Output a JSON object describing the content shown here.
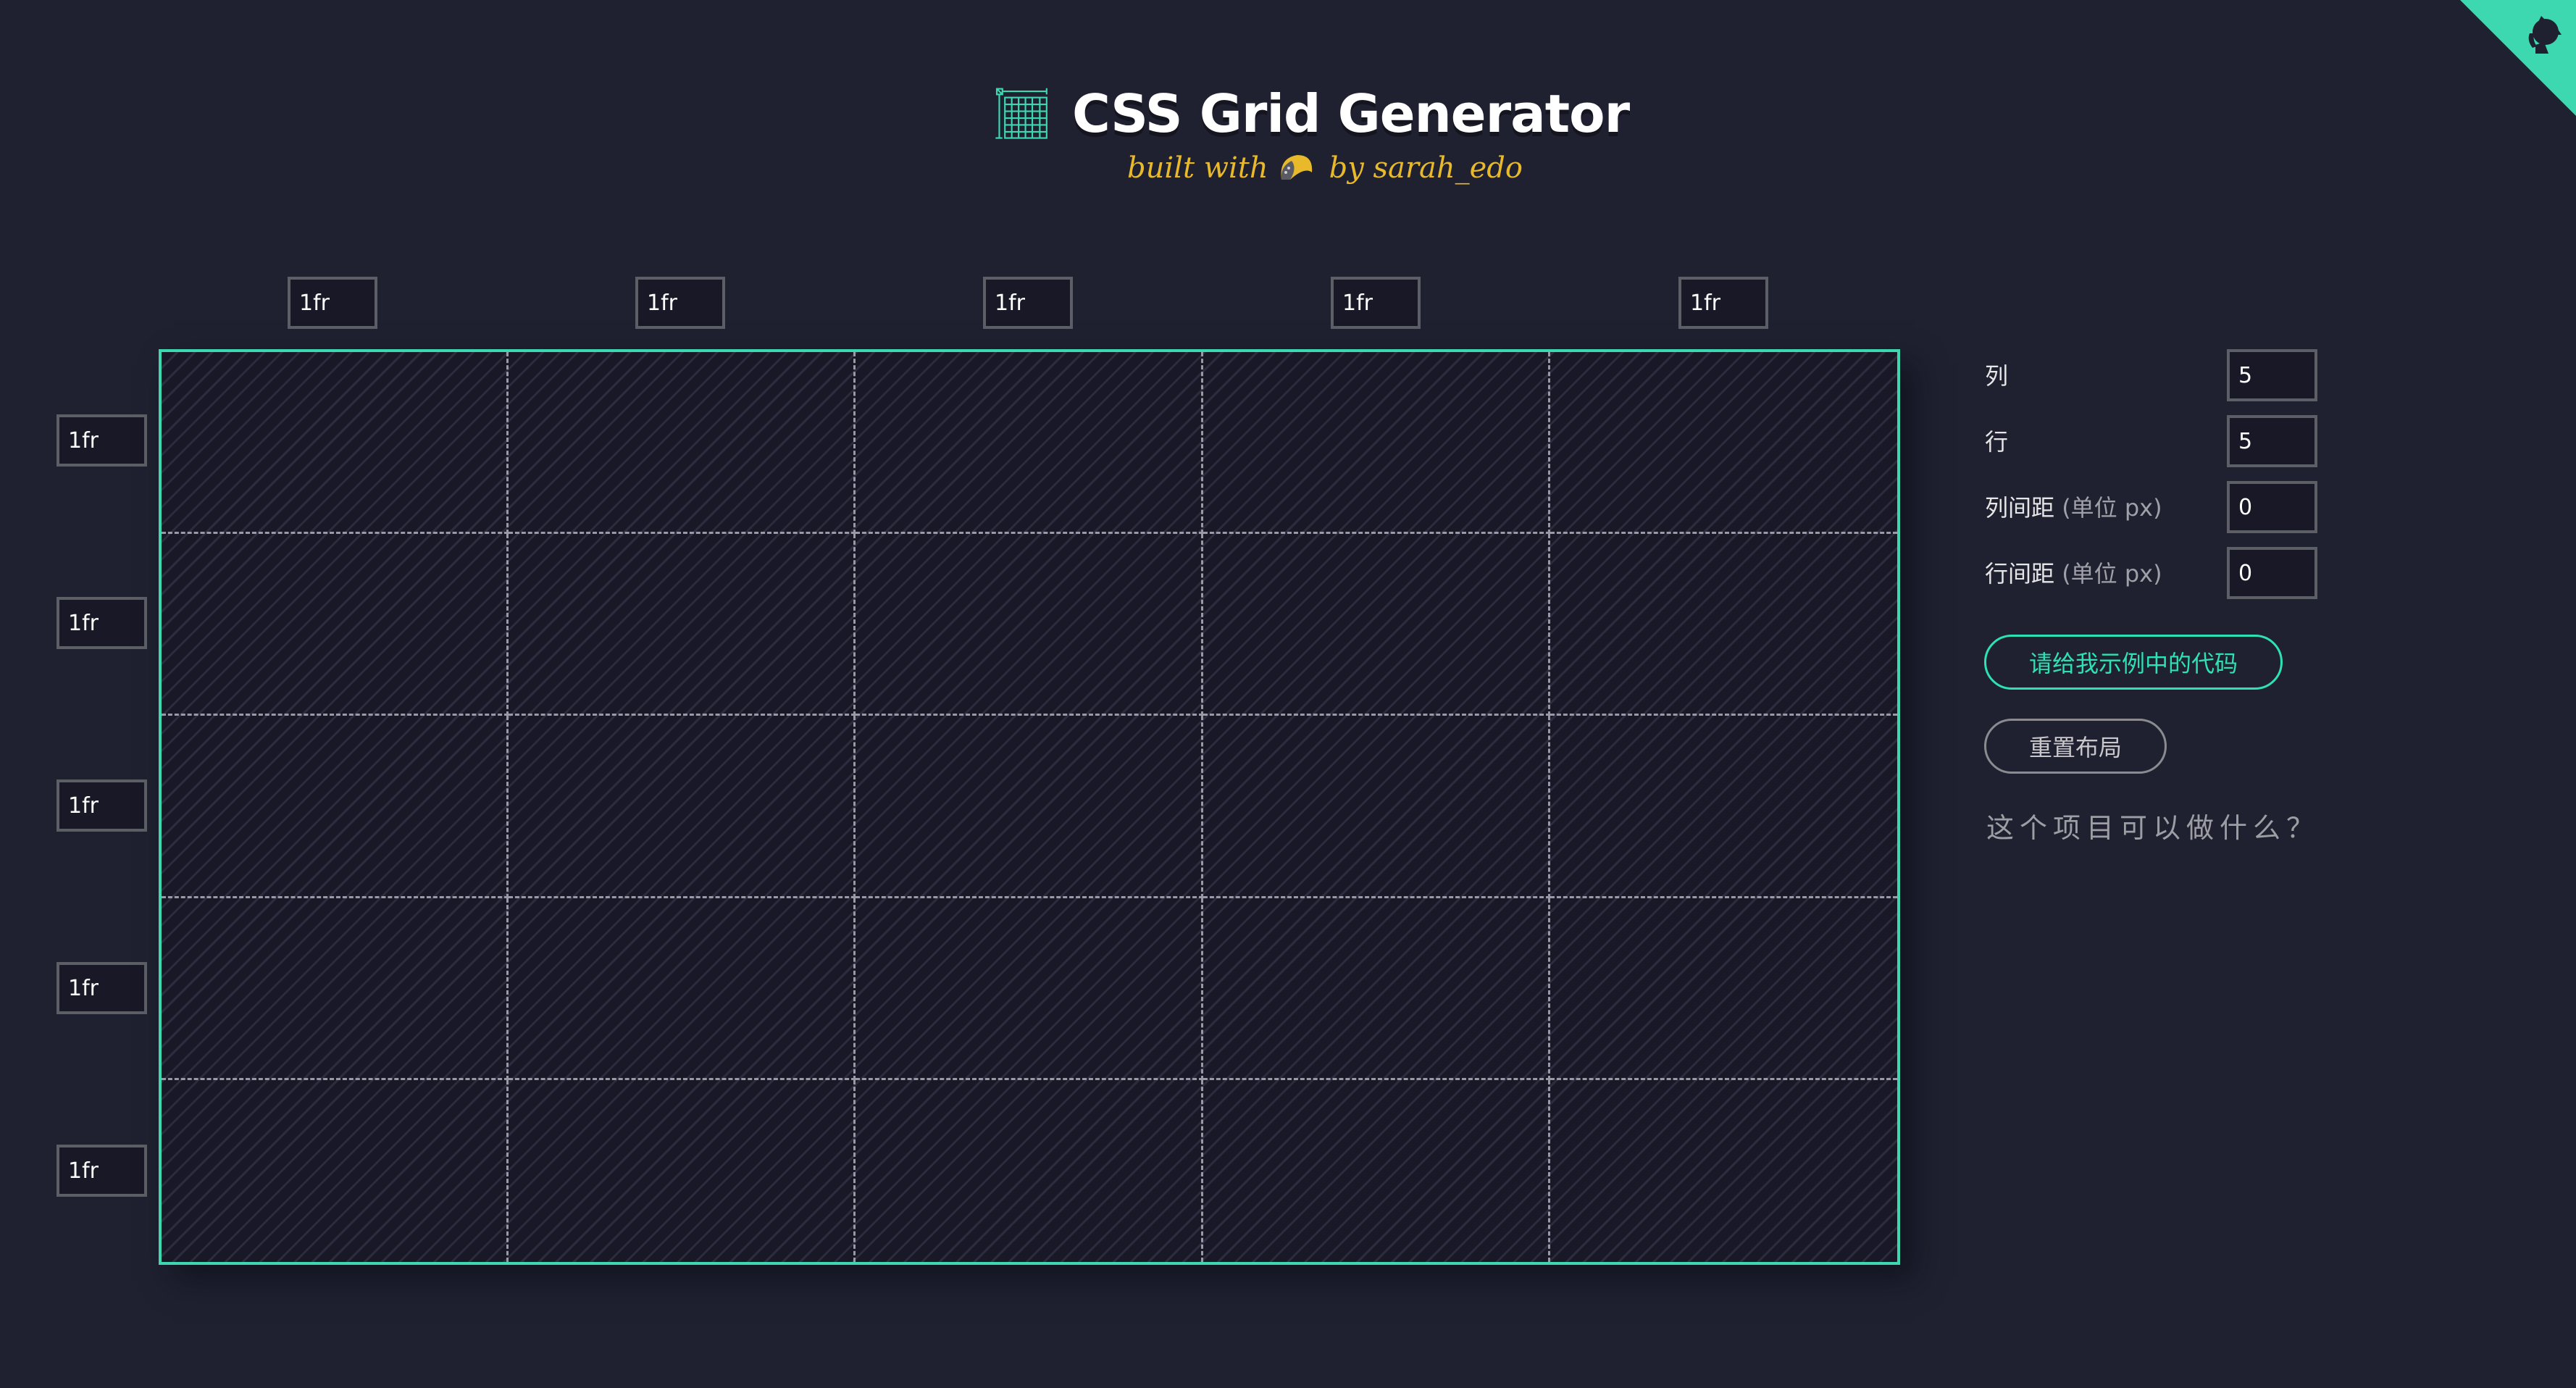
{
  "header": {
    "title": "CSS Grid Generator",
    "byline_prefix": "built with",
    "byline_suffix": "by sarah_edo",
    "logo_icon": "grid-logo-icon",
    "taco_icon": "taco-icon",
    "corner_icon": "github-octocat-icon"
  },
  "colors": {
    "background": "#1f2130",
    "accent": "#3dd8b0",
    "byline": "#e8b92a",
    "grid_line": "#9a9aa6"
  },
  "grid": {
    "columns": [
      "1fr",
      "1fr",
      "1fr",
      "1fr",
      "1fr"
    ],
    "rows": [
      "1fr",
      "1fr",
      "1fr",
      "1fr",
      "1fr"
    ]
  },
  "controls": {
    "columns_label": "列",
    "columns_value": "5",
    "rows_label": "行",
    "rows_value": "5",
    "column_gap_label": "列间距",
    "column_gap_unit": "(单位 px)",
    "column_gap_value": "0",
    "row_gap_label": "行间距",
    "row_gap_unit": "(单位 px)",
    "row_gap_value": "0"
  },
  "buttons": {
    "show_code": "请给我示例中的代码",
    "reset": "重置布局"
  },
  "help_link": "这个项目可以做什么？"
}
